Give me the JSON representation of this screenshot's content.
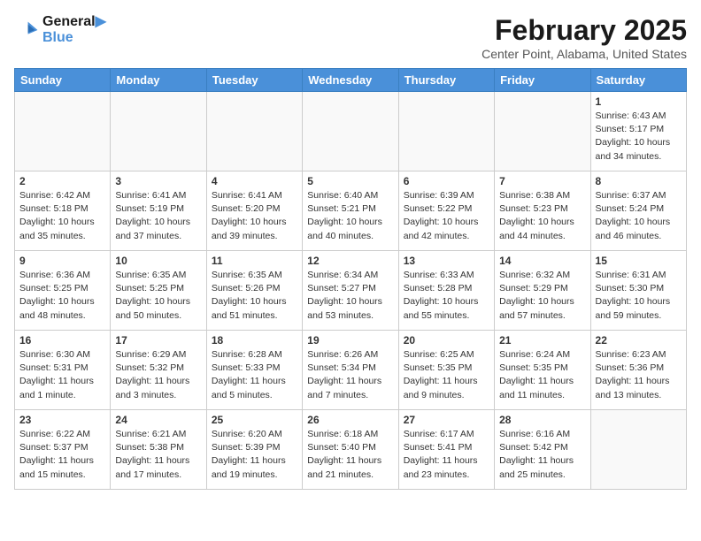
{
  "logo": {
    "line1": "General",
    "line2": "Blue"
  },
  "title": "February 2025",
  "subtitle": "Center Point, Alabama, United States",
  "weekdays": [
    "Sunday",
    "Monday",
    "Tuesday",
    "Wednesday",
    "Thursday",
    "Friday",
    "Saturday"
  ],
  "weeks": [
    [
      {
        "day": "",
        "info": ""
      },
      {
        "day": "",
        "info": ""
      },
      {
        "day": "",
        "info": ""
      },
      {
        "day": "",
        "info": ""
      },
      {
        "day": "",
        "info": ""
      },
      {
        "day": "",
        "info": ""
      },
      {
        "day": "1",
        "info": "Sunrise: 6:43 AM\nSunset: 5:17 PM\nDaylight: 10 hours and 34 minutes."
      }
    ],
    [
      {
        "day": "2",
        "info": "Sunrise: 6:42 AM\nSunset: 5:18 PM\nDaylight: 10 hours and 35 minutes."
      },
      {
        "day": "3",
        "info": "Sunrise: 6:41 AM\nSunset: 5:19 PM\nDaylight: 10 hours and 37 minutes."
      },
      {
        "day": "4",
        "info": "Sunrise: 6:41 AM\nSunset: 5:20 PM\nDaylight: 10 hours and 39 minutes."
      },
      {
        "day": "5",
        "info": "Sunrise: 6:40 AM\nSunset: 5:21 PM\nDaylight: 10 hours and 40 minutes."
      },
      {
        "day": "6",
        "info": "Sunrise: 6:39 AM\nSunset: 5:22 PM\nDaylight: 10 hours and 42 minutes."
      },
      {
        "day": "7",
        "info": "Sunrise: 6:38 AM\nSunset: 5:23 PM\nDaylight: 10 hours and 44 minutes."
      },
      {
        "day": "8",
        "info": "Sunrise: 6:37 AM\nSunset: 5:24 PM\nDaylight: 10 hours and 46 minutes."
      }
    ],
    [
      {
        "day": "9",
        "info": "Sunrise: 6:36 AM\nSunset: 5:25 PM\nDaylight: 10 hours and 48 minutes."
      },
      {
        "day": "10",
        "info": "Sunrise: 6:35 AM\nSunset: 5:25 PM\nDaylight: 10 hours and 50 minutes."
      },
      {
        "day": "11",
        "info": "Sunrise: 6:35 AM\nSunset: 5:26 PM\nDaylight: 10 hours and 51 minutes."
      },
      {
        "day": "12",
        "info": "Sunrise: 6:34 AM\nSunset: 5:27 PM\nDaylight: 10 hours and 53 minutes."
      },
      {
        "day": "13",
        "info": "Sunrise: 6:33 AM\nSunset: 5:28 PM\nDaylight: 10 hours and 55 minutes."
      },
      {
        "day": "14",
        "info": "Sunrise: 6:32 AM\nSunset: 5:29 PM\nDaylight: 10 hours and 57 minutes."
      },
      {
        "day": "15",
        "info": "Sunrise: 6:31 AM\nSunset: 5:30 PM\nDaylight: 10 hours and 59 minutes."
      }
    ],
    [
      {
        "day": "16",
        "info": "Sunrise: 6:30 AM\nSunset: 5:31 PM\nDaylight: 11 hours and 1 minute."
      },
      {
        "day": "17",
        "info": "Sunrise: 6:29 AM\nSunset: 5:32 PM\nDaylight: 11 hours and 3 minutes."
      },
      {
        "day": "18",
        "info": "Sunrise: 6:28 AM\nSunset: 5:33 PM\nDaylight: 11 hours and 5 minutes."
      },
      {
        "day": "19",
        "info": "Sunrise: 6:26 AM\nSunset: 5:34 PM\nDaylight: 11 hours and 7 minutes."
      },
      {
        "day": "20",
        "info": "Sunrise: 6:25 AM\nSunset: 5:35 PM\nDaylight: 11 hours and 9 minutes."
      },
      {
        "day": "21",
        "info": "Sunrise: 6:24 AM\nSunset: 5:35 PM\nDaylight: 11 hours and 11 minutes."
      },
      {
        "day": "22",
        "info": "Sunrise: 6:23 AM\nSunset: 5:36 PM\nDaylight: 11 hours and 13 minutes."
      }
    ],
    [
      {
        "day": "23",
        "info": "Sunrise: 6:22 AM\nSunset: 5:37 PM\nDaylight: 11 hours and 15 minutes."
      },
      {
        "day": "24",
        "info": "Sunrise: 6:21 AM\nSunset: 5:38 PM\nDaylight: 11 hours and 17 minutes."
      },
      {
        "day": "25",
        "info": "Sunrise: 6:20 AM\nSunset: 5:39 PM\nDaylight: 11 hours and 19 minutes."
      },
      {
        "day": "26",
        "info": "Sunrise: 6:18 AM\nSunset: 5:40 PM\nDaylight: 11 hours and 21 minutes."
      },
      {
        "day": "27",
        "info": "Sunrise: 6:17 AM\nSunset: 5:41 PM\nDaylight: 11 hours and 23 minutes."
      },
      {
        "day": "28",
        "info": "Sunrise: 6:16 AM\nSunset: 5:42 PM\nDaylight: 11 hours and 25 minutes."
      },
      {
        "day": "",
        "info": ""
      }
    ]
  ]
}
